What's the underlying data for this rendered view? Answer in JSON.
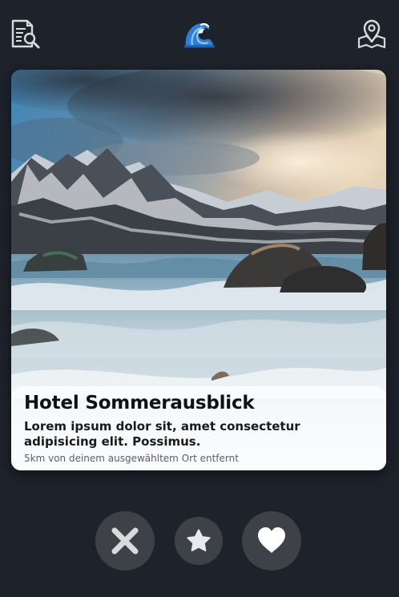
{
  "header": {
    "left_icon": "document-search-icon",
    "center_icon": "wave-icon",
    "right_icon": "map-pin-icon"
  },
  "card": {
    "image": "mountain-sea-photo",
    "title": "Hotel Sommerausblick",
    "description": "Lorem ipsum dolor sit, amet consectetur adipisicing elit. Possimus.",
    "distance": "5km von deinem ausgewähltem Ort entfernt"
  },
  "actions": {
    "reject_icon": "x-icon",
    "favorite_icon": "star-icon",
    "like_icon": "heart-icon"
  },
  "colors": {
    "background": "#1d222b",
    "action_bg": "#3e4248",
    "icon_light": "#e8e9eb"
  }
}
